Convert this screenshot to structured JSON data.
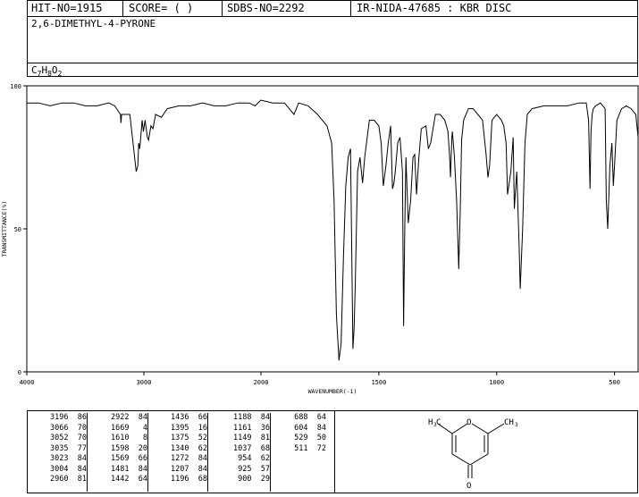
{
  "header": {
    "hit_no": "HIT-NO=1915",
    "score": "SCORE=  (   )",
    "sdbs_no": "SDBS-NO=2292",
    "ir_id": "IR-NIDA-47685 : KBR DISC",
    "compound_name": "2,6-DIMETHYL-4-PYRONE",
    "formula": {
      "c": "C",
      "c_n": "7",
      "h": "H",
      "h_n": "8",
      "o": "O",
      "o_n": "2"
    }
  },
  "chart_data": {
    "type": "line",
    "title": "",
    "xlabel": "WAVENUMBER(-1)",
    "ylabel": "TRANSMITTANCE(%)",
    "xlim": [
      4000,
      400
    ],
    "ylim": [
      0,
      100
    ],
    "x_ticks": [
      "4000",
      "3000",
      "2000",
      "1500",
      "1000",
      "500"
    ],
    "y_ticks": [
      "0",
      "50",
      "100"
    ],
    "grid": false,
    "series": [
      {
        "x": [
          4000,
          3900,
          3800,
          3700,
          3600,
          3500,
          3400,
          3300,
          3250,
          3200,
          3196,
          3190,
          3120,
          3066,
          3052,
          3044,
          3035,
          3023,
          3015,
          3004,
          2990,
          2970,
          2960,
          2940,
          2922,
          2900,
          2850,
          2800,
          2700,
          2600,
          2500,
          2400,
          2300,
          2200,
          2100,
          2050,
          2000,
          1950,
          1900,
          1860,
          1840,
          1800,
          1760,
          1720,
          1700,
          1690,
          1680,
          1669,
          1660,
          1650,
          1640,
          1630,
          1620,
          1610,
          1605,
          1600,
          1590,
          1580,
          1569,
          1560,
          1540,
          1520,
          1500,
          1490,
          1481,
          1470,
          1460,
          1450,
          1442,
          1436,
          1430,
          1420,
          1410,
          1400,
          1395,
          1390,
          1385,
          1375,
          1365,
          1355,
          1348,
          1340,
          1330,
          1320,
          1300,
          1290,
          1280,
          1272,
          1260,
          1240,
          1220,
          1210,
          1207,
          1200,
          1196,
          1190,
          1188,
          1180,
          1170,
          1161,
          1155,
          1149,
          1140,
          1120,
          1100,
          1080,
          1060,
          1045,
          1037,
          1030,
          1020,
          1000,
          980,
          970,
          960,
          954,
          940,
          930,
          925,
          915,
          905,
          900,
          890,
          880,
          870,
          850,
          800,
          750,
          700,
          650,
          620,
          610,
          604,
          600,
          595,
          590,
          580,
          560,
          540,
          535,
          529,
          520,
          511,
          505,
          500,
          490,
          470,
          450,
          430,
          410,
          400
        ],
        "y": [
          94,
          94,
          93,
          94,
          94,
          93,
          93,
          94,
          93,
          90,
          87,
          90,
          90,
          70,
          72,
          80,
          78,
          84,
          88,
          84,
          88,
          82,
          81,
          86,
          85,
          90,
          89,
          92,
          93,
          93,
          94,
          93,
          93,
          94,
          94,
          93,
          95,
          94,
          94,
          90,
          94,
          93,
          90,
          86,
          80,
          60,
          20,
          4,
          10,
          40,
          65,
          75,
          78,
          8,
          15,
          30,
          70,
          75,
          66,
          75,
          88,
          88,
          86,
          80,
          65,
          72,
          80,
          86,
          64,
          66,
          70,
          80,
          82,
          70,
          16,
          50,
          75,
          52,
          60,
          75,
          76,
          62,
          75,
          85,
          86,
          78,
          80,
          84,
          90,
          90,
          88,
          85,
          84,
          76,
          68,
          82,
          84,
          76,
          60,
          36,
          55,
          81,
          88,
          92,
          92,
          90,
          88,
          76,
          68,
          72,
          88,
          90,
          88,
          86,
          80,
          62,
          70,
          82,
          57,
          70,
          45,
          29,
          50,
          80,
          90,
          92,
          93,
          93,
          93,
          94,
          94,
          88,
          64,
          84,
          90,
          92,
          93,
          94,
          92,
          60,
          50,
          72,
          80,
          65,
          72,
          88,
          92,
          93,
          92,
          90,
          82
        ]
      }
    ]
  }
}
